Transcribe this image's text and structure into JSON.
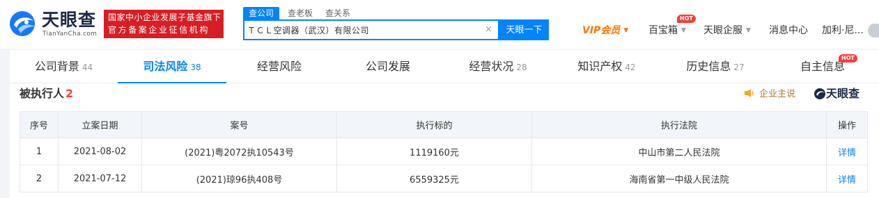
{
  "header": {
    "logo_name": "天眼查",
    "logo_domain": "TianYanCha.com",
    "banner_line1": "国家中小企业发展子基金旗下",
    "banner_line2": "官方备案企业征信机构",
    "search_tabs": [
      "查公司",
      "查老板",
      "查关系"
    ],
    "search_value": "ＴＣＬ空调器（武汉）有限公司",
    "clear_glyph": "×",
    "search_button": "天眼一下",
    "nav": {
      "vip": "VIP会员",
      "treasure": "百宝箱",
      "enterprise": "天眼企服",
      "messages": "消息中心",
      "user": "加利·尼..."
    },
    "hot_badge": "HOT",
    "caret": "▼"
  },
  "tabs": [
    {
      "label": "公司背景",
      "count": "44"
    },
    {
      "label": "司法风险",
      "count": "38"
    },
    {
      "label": "经营风险",
      "count": ""
    },
    {
      "label": "公司发展",
      "count": ""
    },
    {
      "label": "经营状况",
      "count": "28"
    },
    {
      "label": "知识产权",
      "count": "42"
    },
    {
      "label": "历史信息",
      "count": "27"
    },
    {
      "label": "自主信息",
      "count": ""
    }
  ],
  "active_tab": 1,
  "section": {
    "title": "被执行人",
    "count": "2",
    "promo_label": "企业主说",
    "watermark": "天眼查"
  },
  "table": {
    "headers": [
      "序号",
      "立案日期",
      "案号",
      "执行标的",
      "执行法院",
      "操作"
    ],
    "rows": [
      {
        "index": "1",
        "date": "2021-08-02",
        "case_no": "(2021)粤2072执10543号",
        "amount": "1119160元",
        "court": "中山市第二人民法院",
        "action": "详情"
      },
      {
        "index": "2",
        "date": "2021-07-12",
        "case_no": "(2021)琼96执408号",
        "amount": "6559325元",
        "court": "海南省第一中级人民法院",
        "action": "详情"
      }
    ]
  },
  "colors": {
    "brand_blue": "#0084ff",
    "banner_red": "#d71e24",
    "vip_orange": "#ff7200",
    "hot_red": "#f43f3b",
    "promo_gold": "#ad7b2b"
  }
}
